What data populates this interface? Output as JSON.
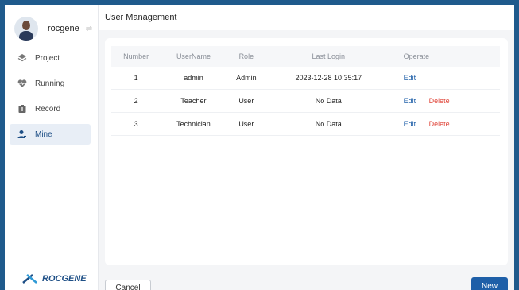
{
  "user": {
    "name": "rocgene",
    "switch_icon": "swap-icon"
  },
  "nav": [
    {
      "label": "Project",
      "icon": "layers-icon"
    },
    {
      "label": "Running",
      "icon": "heartbeat-icon"
    },
    {
      "label": "Record",
      "icon": "record-icon"
    },
    {
      "label": "Mine",
      "icon": "user-icon",
      "active": true
    }
  ],
  "logo": {
    "text": "ROCGENE"
  },
  "header": {
    "title": "User Management"
  },
  "table": {
    "columns": [
      "Number",
      "UserName",
      "Role",
      "Last Login",
      "Operate"
    ],
    "rows": [
      {
        "number": "1",
        "username": "admin",
        "role": "Admin",
        "last_login": "2023-12-28 10:35:17",
        "edit": "Edit",
        "delete": ""
      },
      {
        "number": "2",
        "username": "Teacher",
        "role": "User",
        "last_login": "No Data",
        "edit": "Edit",
        "delete": "Delete"
      },
      {
        "number": "3",
        "username": "Technician",
        "role": "User",
        "last_login": "No Data",
        "edit": "Edit",
        "delete": "Delete"
      }
    ]
  },
  "buttons": {
    "cancel": "Cancel",
    "new": "New"
  },
  "colors": {
    "accent": "#1e5fa8",
    "danger": "#e0473b",
    "frame": "#1f5a8c"
  }
}
